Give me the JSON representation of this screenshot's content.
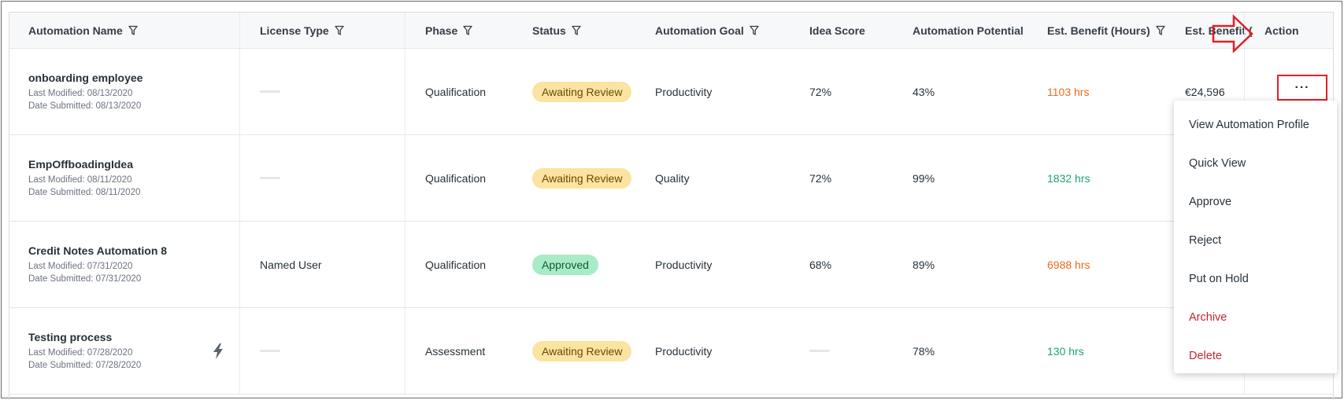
{
  "table": {
    "columns": [
      {
        "label": "Automation Name",
        "filter": true
      },
      {
        "label": "License Type",
        "filter": true
      },
      {
        "label": "Phase",
        "filter": true
      },
      {
        "label": "Status",
        "filter": true
      },
      {
        "label": "Automation Goal",
        "filter": true
      },
      {
        "label": "Idea Score",
        "filter": false
      },
      {
        "label": "Automation Potential",
        "filter": false
      },
      {
        "label": "Est. Benefit (Hours)",
        "filter": true
      },
      {
        "label": "Est. Benefit (",
        "filter": false
      },
      {
        "label": "Action",
        "filter": false
      }
    ],
    "rows": [
      {
        "name": "onboarding employee",
        "last_modified": "Last Modified: 08/13/2020",
        "date_submitted": "Date Submitted: 08/13/2020",
        "license": "",
        "phase": "Qualification",
        "status": "Awaiting Review",
        "goal": "Productivity",
        "idea_score": "72%",
        "potential": "43%",
        "benefit_hours": "1103 hrs",
        "benefit_color": "#ee6a19",
        "benefit_money": "€24,596"
      },
      {
        "name": "EmpOffboadingIdea",
        "last_modified": "Last Modified: 08/11/2020",
        "date_submitted": "Date Submitted: 08/11/2020",
        "license": "",
        "phase": "Qualification",
        "status": "Awaiting Review",
        "goal": "Quality",
        "idea_score": "72%",
        "potential": "99%",
        "benefit_hours": "1832 hrs",
        "benefit_color": "#1aa56d",
        "benefit_money": ""
      },
      {
        "name": "Credit Notes Automation 8",
        "last_modified": "Last Modified: 07/31/2020",
        "date_submitted": "Date Submitted: 07/31/2020",
        "license": "Named User",
        "phase": "Qualification",
        "status": "Approved",
        "goal": "Productivity",
        "idea_score": "68%",
        "potential": "89%",
        "benefit_hours": "6988 hrs",
        "benefit_color": "#ee6a19",
        "benefit_money": ""
      },
      {
        "name": "Testing process",
        "last_modified": "Last Modified: 07/28/2020",
        "date_submitted": "Date Submitted: 07/28/2020",
        "license": "",
        "phase": "Assessment",
        "status": "Awaiting Review",
        "goal": "Productivity",
        "idea_score": "",
        "potential": "78%",
        "benefit_hours": "130 hrs",
        "benefit_color": "#1aa56d",
        "benefit_money": ""
      }
    ]
  },
  "action_button_label": "···",
  "menu": {
    "items": [
      {
        "label": "View Automation Profile",
        "danger": false
      },
      {
        "label": "Quick View",
        "danger": false
      },
      {
        "label": "Approve",
        "danger": false
      },
      {
        "label": "Reject",
        "danger": false
      },
      {
        "label": "Put on Hold",
        "danger": false
      },
      {
        "label": "Archive",
        "danger": true
      },
      {
        "label": "Delete",
        "danger": true
      }
    ]
  },
  "colors": {
    "awaiting_review_bg": "#fbe3a2",
    "approved_bg": "#a8ecc7",
    "highlight_red": "#e0202a"
  },
  "icons": {
    "filter": "filter-icon",
    "bolt": "lightning-bolt-icon",
    "arrow": "right-arrow-icon"
  }
}
